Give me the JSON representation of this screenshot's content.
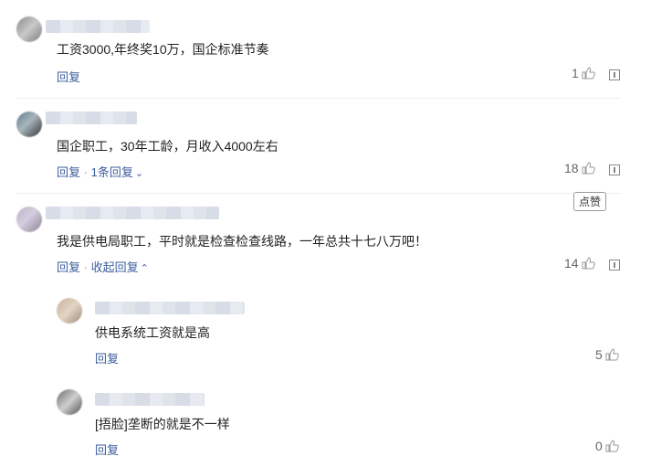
{
  "comments": [
    {
      "text": "工资3000,年终奖10万，国企标准节奏",
      "reply": "回复",
      "likes": "1"
    },
    {
      "text": "国企职工，30年工龄，月收入4000左右",
      "reply": "回复",
      "separator": "·",
      "reply_count": "1条回复",
      "likes": "18"
    },
    {
      "text": "我是供电局职工，平时就是检查检查线路，一年总共十七八万吧！",
      "reply": "回复",
      "separator": "·",
      "collapse": "收起回复",
      "likes": "14"
    }
  ],
  "replies": [
    {
      "text": "供电系统工资就是高",
      "reply": "回复",
      "likes": "5"
    },
    {
      "text": "[捂脸]垄断的就是不一样",
      "reply": "回复",
      "likes": "0"
    }
  ],
  "tooltip": "点赞",
  "icons": {
    "like": "thumbs-up-icon",
    "report": "report-icon",
    "expand": "chevron-down-icon",
    "collapse": "chevron-up-icon"
  },
  "colors": {
    "link": "#3c5e9c",
    "text": "#222222",
    "muted": "#666666"
  }
}
